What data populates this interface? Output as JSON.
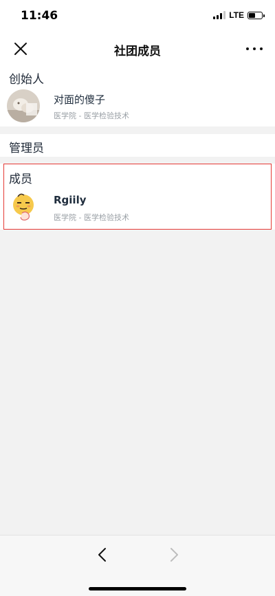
{
  "status_bar": {
    "time": "11:46",
    "network": "LTE",
    "icons": [
      "signal-icon",
      "battery-icon"
    ]
  },
  "nav": {
    "title": "社团成员",
    "close_icon": "close-icon",
    "more_icon": "more-icon"
  },
  "sections": {
    "founder": {
      "title": "创始人",
      "members": [
        {
          "name": "对面的傻子",
          "meta": "医学院 - 医学检验技术"
        }
      ]
    },
    "admins": {
      "title": "管理员",
      "members": []
    },
    "members": {
      "title": "成员",
      "members": [
        {
          "name": "Rgiily",
          "meta": "医学院 - 医学检验技术"
        }
      ]
    }
  },
  "colors": {
    "highlight": "#e53935",
    "background": "#f2f2f2",
    "meta_text": "#9aa0a6"
  },
  "bottom_bar": {
    "back_icon": "chevron-left-icon",
    "forward_icon": "chevron-right-icon"
  }
}
